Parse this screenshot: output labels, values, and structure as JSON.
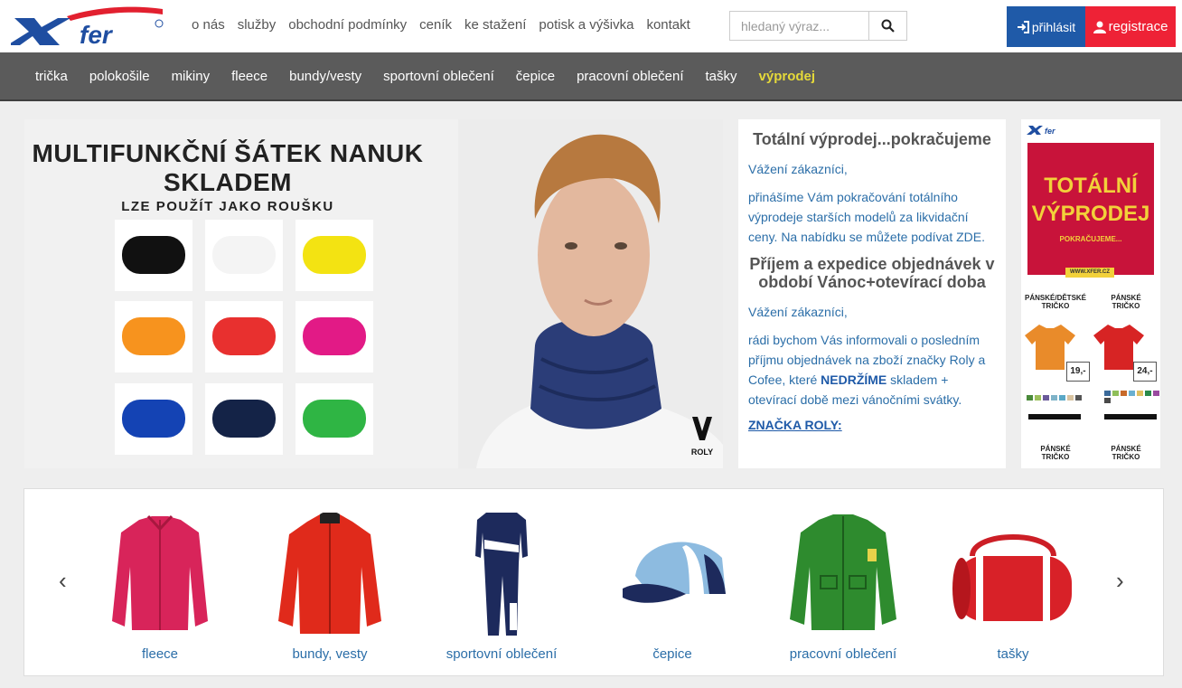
{
  "header": {
    "logo_text": "fer",
    "top_links": [
      "o nás",
      "služby",
      "obchodní podmínky",
      "ceník",
      "ke stažení",
      "potisk a výšivka",
      "kontakt"
    ],
    "search_placeholder": "hledaný výraz...",
    "login_label": "přihlásit",
    "register_label": "registrace",
    "login_color": "#1f5aa8",
    "register_color": "#ee2236"
  },
  "nav": {
    "items": [
      "trička",
      "polokošile",
      "mikiny",
      "fleece",
      "bundy/vesty",
      "sportovní oblečení",
      "čepice",
      "pracovní oblečení",
      "tašky"
    ],
    "sale_label": "výprodej",
    "sale_color": "#e5d93a"
  },
  "banner": {
    "headline_line1": "MULTIFUNKČNÍ ŠÁTEK NANUK",
    "headline_line2": "SKLADEM",
    "subline": "LZE POUŽÍT JAKO ROUŠKU",
    "swatch_colors": [
      "#111111",
      "#f4f4f4",
      "#f3e312",
      "#f7931e",
      "#e8302f",
      "#e21a86",
      "#1443b4",
      "#142347",
      "#2fb544"
    ],
    "brand": "ROLY"
  },
  "news": {
    "title1": "Totální výprodej...pokračujeme",
    "p1": "Vážení zákazníci,",
    "p2": "přinášíme Vám pokračování totálního výprodeje starších modelů za likvidační ceny. Na nabídku se můžete podívat ZDE.",
    "title2": "Příjem a expedice objednávek v období Vánoc+otevírací doba",
    "p3": "Vážení zákazníci,",
    "p4_before": "rádi bychom Vás informovali o posledním příjmu objednávek na zboží značky Roly a Cofee, které ",
    "p4_bold": "NEDRŽÍME",
    "p4_after": " skladem + otevírací době mezi vánočními svátky.",
    "link": "ZNAČKA ROLY:"
  },
  "poster": {
    "big_line1": "TOTÁLNÍ",
    "big_line2": "VÝPRODEJ",
    "small": "POKRAČUJEME...",
    "www": "WWW.XFER.CZ",
    "cap1_line1": "PÁNSKÉ/DĚTSKÉ",
    "cap1_line2": "TRIČKO",
    "cap2_line1": "PÁNSKÉ",
    "cap2_line2": "TRIČKO",
    "price1": "19,-",
    "price2": "24,-",
    "cap3_line1": "PÁNSKÉ",
    "cap3_line2": "TRIČKO",
    "cap4_line1": "PÁNSKÉ",
    "cap4_line2": "TRIČKO"
  },
  "carousel": {
    "prev": "‹",
    "next": "›",
    "items": [
      {
        "label": "fleece",
        "icon": "fleece-jacket-image"
      },
      {
        "label": "bundy, vesty",
        "icon": "jacket-image"
      },
      {
        "label": "sportovní oblečení",
        "icon": "tracksuit-image"
      },
      {
        "label": "čepice",
        "icon": "cap-image"
      },
      {
        "label": "pracovní oblečení",
        "icon": "work-jacket-image"
      },
      {
        "label": "tašky",
        "icon": "bag-image"
      }
    ]
  }
}
